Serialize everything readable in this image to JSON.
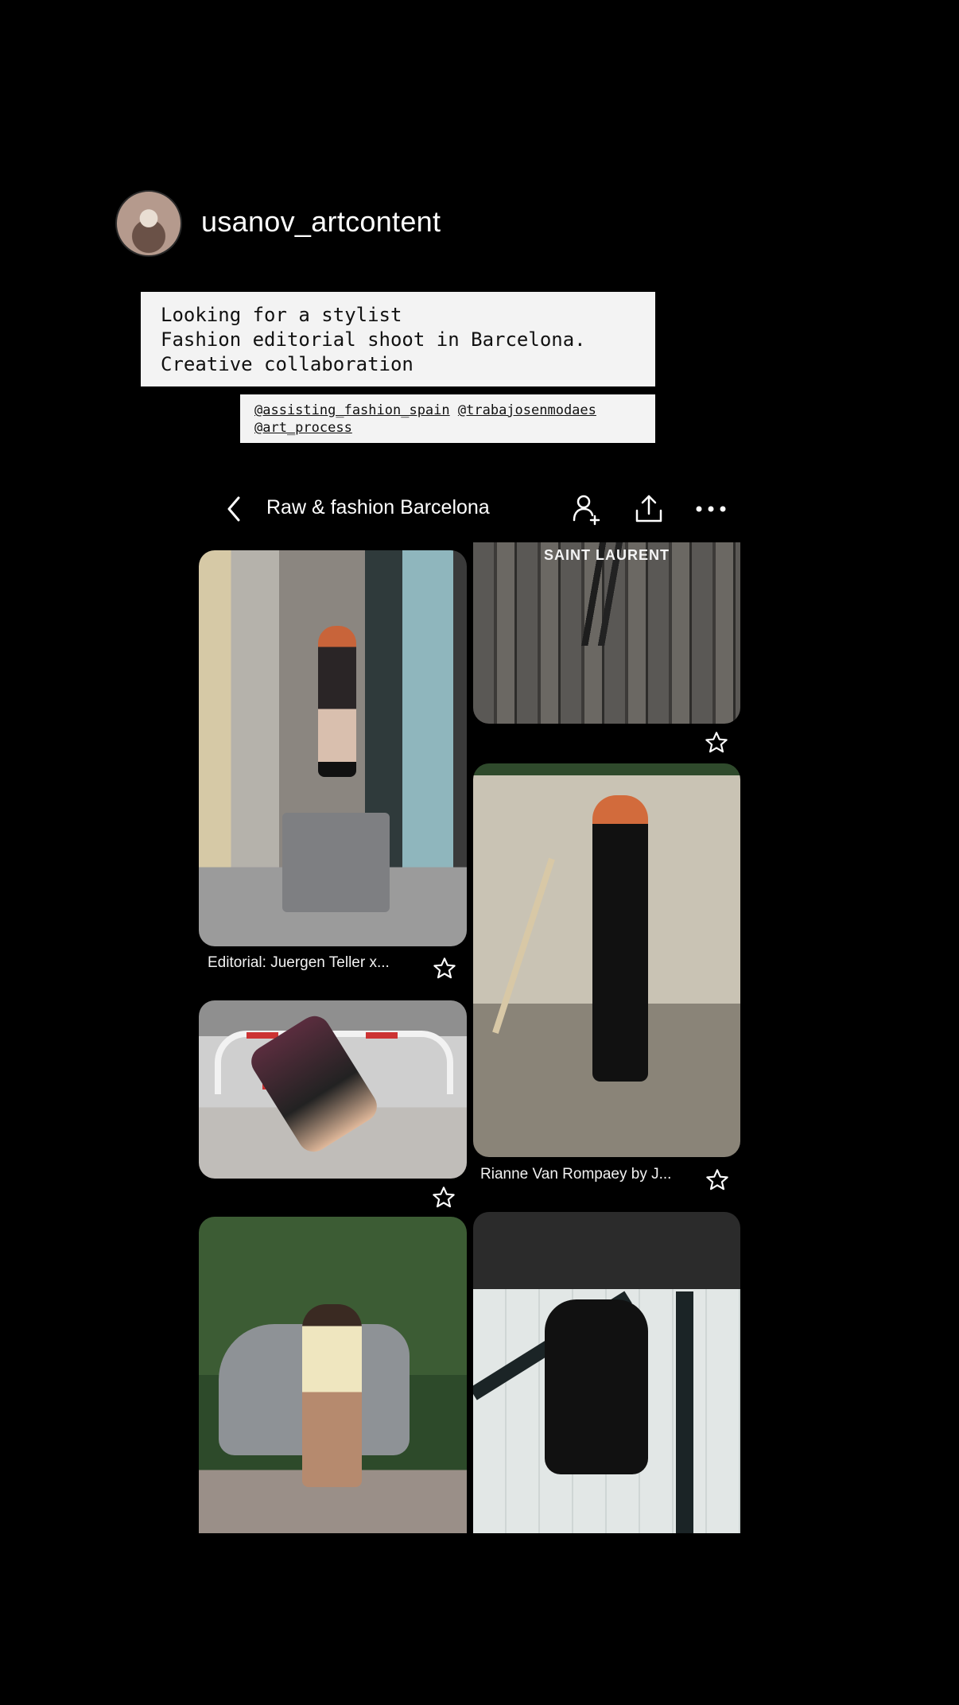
{
  "story": {
    "username": "usanov_artcontent",
    "note_lines": [
      "Looking for a stylist",
      "Fashion editorial shoot in Barcelona.",
      "Creative collaboration"
    ],
    "mentions": [
      "@assisting_fashion_spain",
      "@trabajosenmodaes",
      "@art_process"
    ]
  },
  "board": {
    "title": "Raw & fashion Barcelona",
    "icons": [
      "back-icon",
      "add-collaborator-icon",
      "share-icon",
      "more-icon"
    ]
  },
  "pins": [
    {
      "caption": "Editorial: Juergen Teller x..."
    },
    {
      "overlay_text": "SAINT LAURENT"
    },
    {
      "caption": "Rianne Van Rompaey by J..."
    }
  ],
  "colors": {
    "background": "#000000",
    "note_background": "#f3f3f3",
    "text": "#ffffff"
  }
}
